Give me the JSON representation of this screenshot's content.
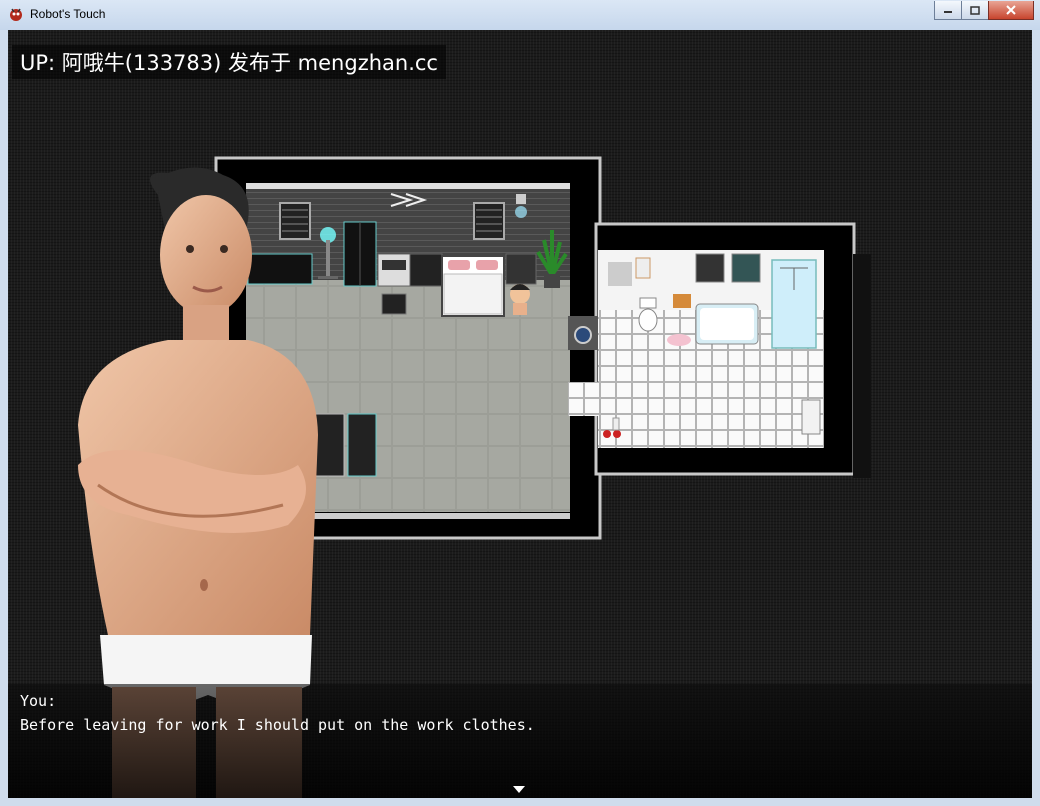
{
  "window": {
    "title": "Robot's Touch"
  },
  "overlay": {
    "up_label": "UP: 阿哦牛(133783) 发布于 mengzhan.cc"
  },
  "dialog": {
    "speaker": "You:",
    "text": "Before leaving for work I should put on the work clothes."
  },
  "icons": {
    "app": "game-app-icon",
    "minimize": "minimize-icon",
    "maximize": "maximize-icon",
    "close": "close-icon",
    "advance": "continue-arrow-icon"
  },
  "colors": {
    "dialog_text": "#ffffff",
    "close_button": "#c7442d",
    "floor": "#9b9d96"
  }
}
